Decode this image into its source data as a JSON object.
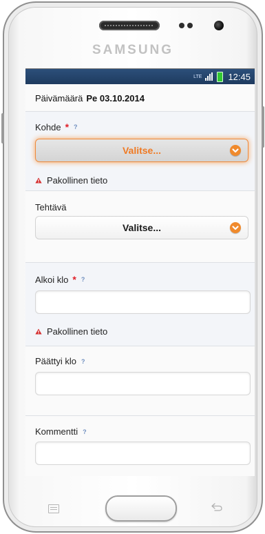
{
  "device": {
    "brand": "SAMSUNG"
  },
  "status_bar": {
    "network": "LTE",
    "time": "12:45"
  },
  "form": {
    "date_label": "Päivämäärä",
    "date_value": "Pe 03.10.2014",
    "kohde": {
      "label": "Kohde",
      "required_mark": "*",
      "help_mark": "?",
      "select_value": "Valitse...",
      "error": "Pakollinen tieto"
    },
    "tehtava": {
      "label": "Tehtävä",
      "select_value": "Valitse..."
    },
    "alkoi": {
      "label": "Alkoi klo",
      "required_mark": "*",
      "help_mark": "?",
      "value": "",
      "error": "Pakollinen tieto"
    },
    "paattyi": {
      "label": "Päättyi klo",
      "help_mark": "?",
      "value": ""
    },
    "kommentti": {
      "label": "Kommentti",
      "help_mark": "?",
      "value": ""
    }
  },
  "colors": {
    "accent_orange": "#f08a2c",
    "required_red": "#e0202a",
    "status_bar_blue": "#1e3b5f"
  }
}
